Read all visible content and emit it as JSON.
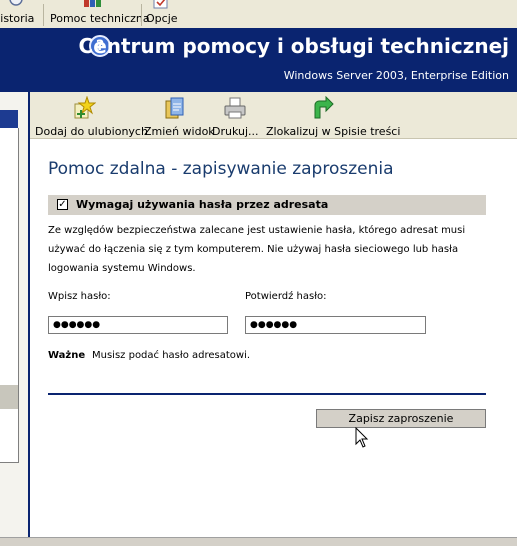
{
  "top_toolbar": {
    "history_label": "Historia",
    "support_label": "Pomoc techniczna",
    "options_label": "Opcje"
  },
  "banner": {
    "title": "Centrum pomocy i obsługi technicznej",
    "subtitle": "Windows Server 2003, Enterprise Edition",
    "help_icon_glyph": "?"
  },
  "content_toolbar": {
    "favorites_label": "Dodaj do ulubionych",
    "change_view_label": "Zmień widok",
    "print_label": "Drukuj...",
    "locate_label": "Zlokalizuj w Spisie treści"
  },
  "main": {
    "page_title": "Pomoc zdalna - zapisywanie zaproszenia",
    "require_password_label": "Wymagaj używania hasła przez adresata",
    "require_password_checked": true,
    "description": "Ze względów bezpieczeństwa zalecane jest ustawienie hasła, którego adresat musi używać do łączenia się z tym komputerem. Nie używaj hasła sieciowego lub hasła logowania systemu Windows.",
    "password_label": "Wpisz hasło:",
    "password_value": "●●●●●●",
    "confirm_label": "Potwierdź hasło:",
    "confirm_value": "●●●●●●",
    "note_label": "Ważne",
    "note_text": "Musisz podać hasło adresatowi.",
    "save_button_label": "Zapisz zaproszenie"
  },
  "colors": {
    "banner_bg": "#0a2470",
    "toolbar_bg": "#ece9d8",
    "title_color": "#1a3c6e",
    "checkbar_bg": "#d4d0c8"
  },
  "icons": {
    "history": "history-clock-icon",
    "support": "support-books-icon",
    "options": "options-checklist-icon",
    "favorites": "add-favorite-star-icon",
    "change_view": "change-view-icon",
    "print": "printer-icon",
    "locate": "locate-arrow-icon"
  }
}
